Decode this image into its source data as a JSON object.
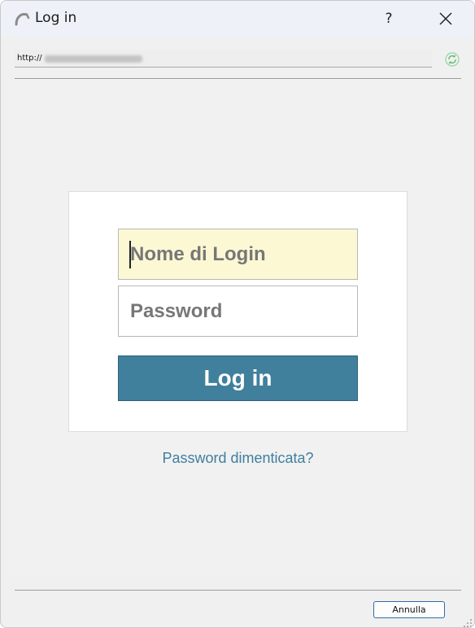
{
  "window": {
    "title": "Log in",
    "help_label": "?"
  },
  "address_bar": {
    "url_prefix": "http://"
  },
  "login_form": {
    "username_placeholder": "Nome di Login",
    "password_placeholder": "Password",
    "submit_label": "Log in",
    "forgot_password_label": "Password dimenticata?"
  },
  "footer": {
    "cancel_label": "Annulla"
  },
  "colors": {
    "submit_button": "#40809c",
    "username_field_bg": "#fcf8d4",
    "link": "#3f7fa0",
    "title_bar": "#eef2f8"
  },
  "icons": {
    "app": "app-logo-icon",
    "close": "close-icon",
    "refresh": "refresh-icon",
    "resize": "resize-grip-icon"
  }
}
